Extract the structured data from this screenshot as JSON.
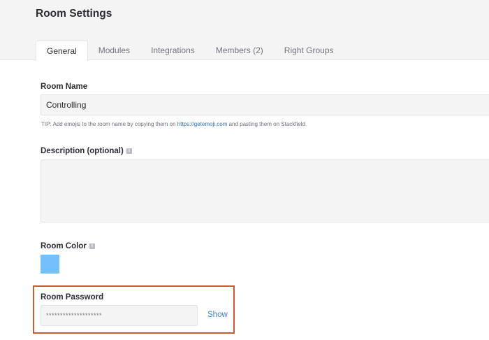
{
  "page": {
    "title": "Room Settings"
  },
  "tabs": [
    {
      "label": "General",
      "active": true
    },
    {
      "label": "Modules"
    },
    {
      "label": "Integrations"
    },
    {
      "label": "Members (2)"
    },
    {
      "label": "Right Groups"
    }
  ],
  "room_name": {
    "label": "Room Name",
    "value": "Controlling"
  },
  "tip": {
    "prefix": "TIP: Add emojis to the room name by copying them on ",
    "link": "https://getemoji.com",
    "suffix": " and pasting them on Stackfield."
  },
  "description": {
    "label": "Description (optional)",
    "value": ""
  },
  "room_color": {
    "label": "Room Color",
    "color": "#74c0fc"
  },
  "password": {
    "label": "Room Password",
    "placeholder": "********************",
    "show_label": "Show"
  },
  "icons": {
    "info": "info-icon"
  }
}
